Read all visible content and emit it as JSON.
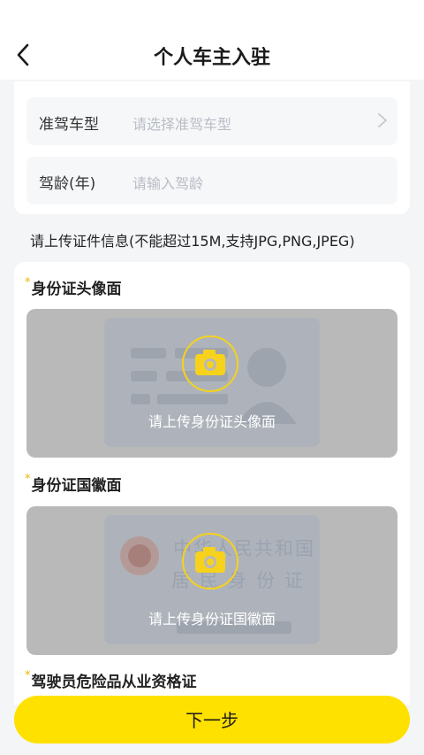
{
  "header": {
    "title": "个人车主入驻"
  },
  "form": {
    "license_type": {
      "label": "准驾车型",
      "placeholder": "请选择准驾车型"
    },
    "driving_years": {
      "label": "驾龄(年)",
      "placeholder": "请输入驾龄"
    }
  },
  "upload_notice": "请上传证件信息(不能超过15M,支持JPG,PNG,JPEG)",
  "sections": [
    {
      "required_mark": "*",
      "title": "身份证头像面",
      "upload_hint": "请上传身份证头像面"
    },
    {
      "required_mark": "*",
      "title": "身份证国徽面",
      "upload_hint": "请上传身份证国徽面",
      "card_text_line1": "中华人民共和国",
      "card_text_line2": "居民身份证"
    },
    {
      "required_mark": "*",
      "title": "驾驶员危险品从业资格证"
    }
  ],
  "footer": {
    "next_label": "下一步"
  },
  "colors": {
    "accent": "#ffe100",
    "required": "#f0b400",
    "placeholder": "#b8bcc4"
  }
}
